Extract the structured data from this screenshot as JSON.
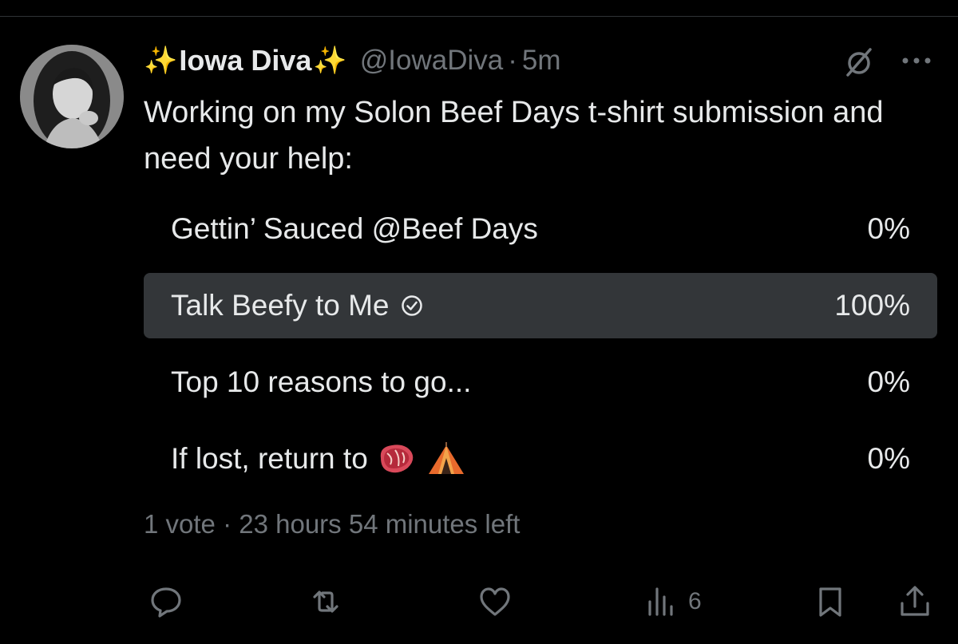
{
  "author": {
    "sparkle_left": "✨",
    "name": "Iowa Diva",
    "sparkle_right": "✨",
    "handle": "@IowaDiva",
    "separator": "·",
    "time": "5m"
  },
  "tweet": {
    "text": "Working on my Solon Beef Days t-shirt submission and need your help:"
  },
  "poll": {
    "options": [
      {
        "label": "Gettin’ Sauced @Beef Days",
        "percent": "0%",
        "share": 0,
        "selected": false
      },
      {
        "label": "Talk Beefy to Me",
        "percent": "100%",
        "share": 1.0,
        "selected": true
      },
      {
        "label": "Top 10 reasons to go...",
        "percent": "0%",
        "share": 0,
        "selected": false
      },
      {
        "label": "If lost, return to",
        "percent": "0%",
        "share": 0,
        "selected": false
      }
    ],
    "votes": "1 vote",
    "separator": "·",
    "time_left": "23 hours 54 minutes left"
  },
  "actions": {
    "views_count": "6"
  },
  "icons": [
    "sparkles-icon",
    "grok-icon",
    "more-icon",
    "check-circle-icon",
    "steak-icon",
    "tent-icon",
    "reply-icon",
    "retweet-icon",
    "like-icon",
    "views-icon",
    "bookmark-icon",
    "share-icon"
  ],
  "colors": {
    "background": "#000000",
    "text": "#e7e9ea",
    "secondary": "#71767b",
    "poll_fill": "#333639",
    "sparkle": "#f2c94c"
  }
}
